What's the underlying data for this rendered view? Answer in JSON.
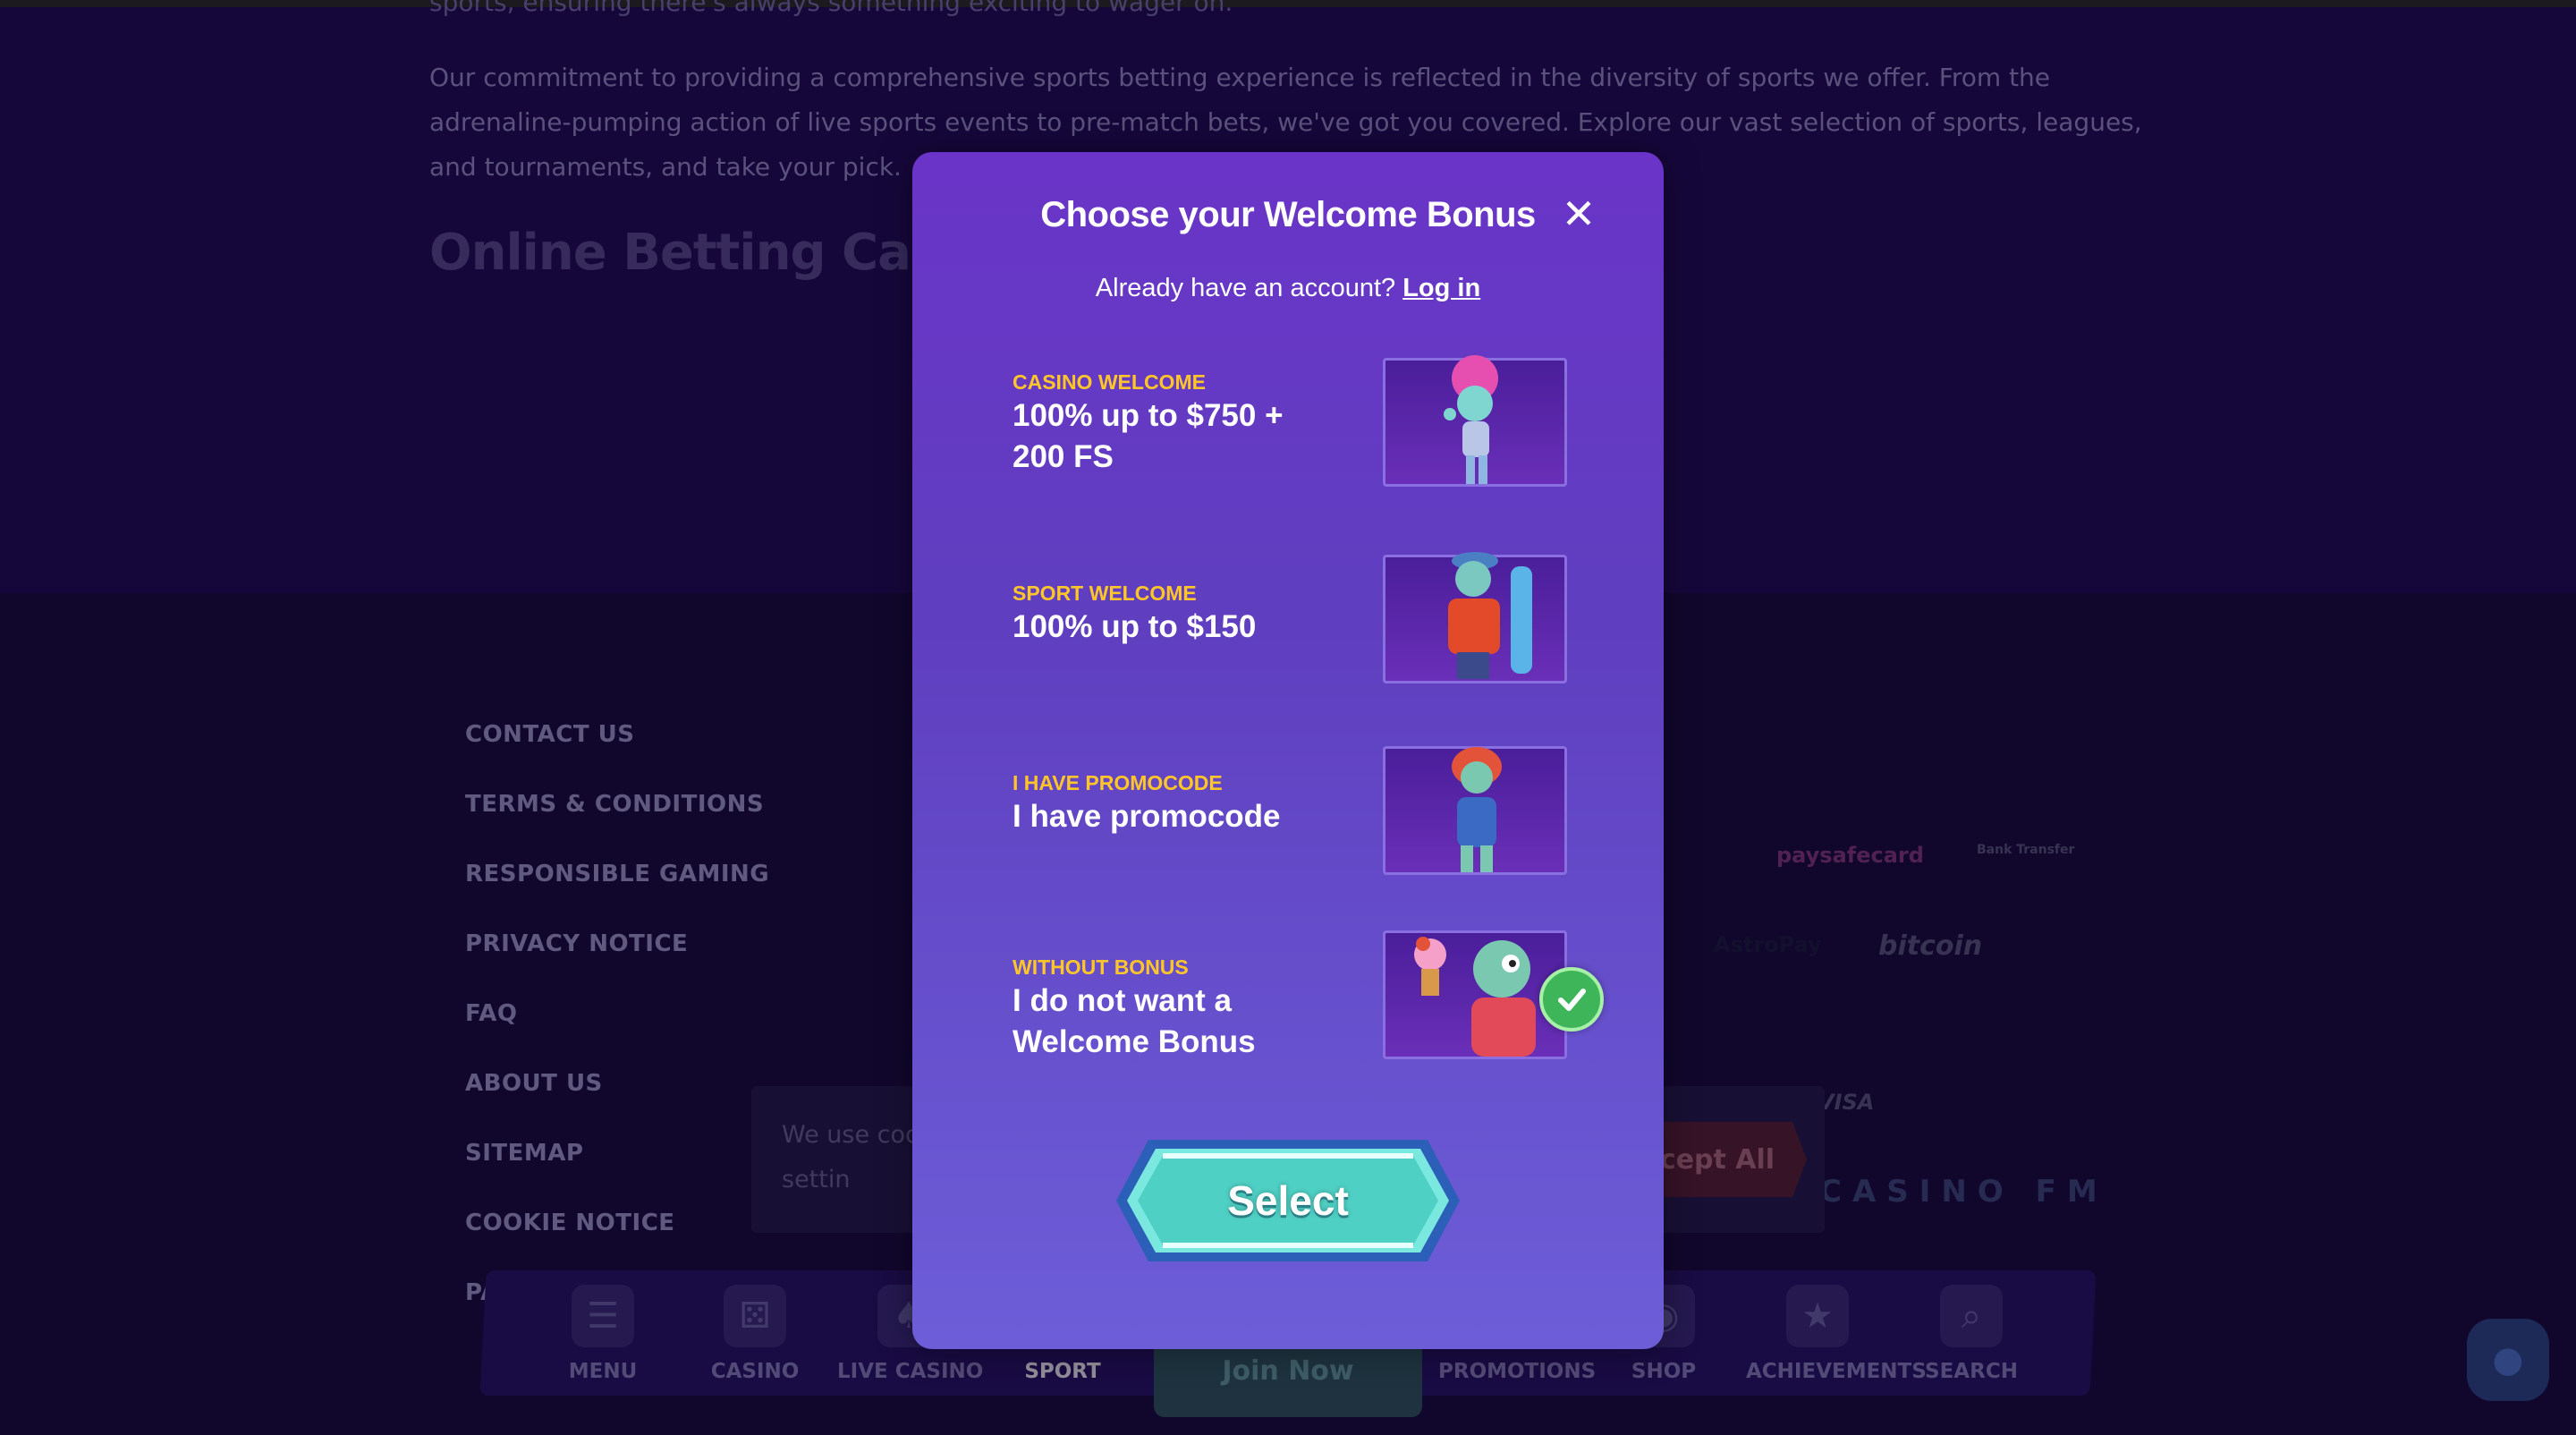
{
  "page": {
    "top_cut_text": "sports, ensuring there's always something exciting to wager on.",
    "intro_paragraph": "Our commitment to providing a comprehensive sports betting experience is reflected in the diversity of sports we offer. From the adrenaline-pumping action of live sports events to pre-match bets, we've got you covered. Explore our vast selection of sports, leagues, and tournaments, and take your pick.",
    "section_heading": "Online Betting Casombie"
  },
  "footer": {
    "links": [
      "CONTACT US",
      "TERMS & CONDITIONS",
      "RESPONSIBLE GAMING",
      "PRIVACY NOTICE",
      "FAQ",
      "ABOUT US",
      "SITEMAP",
      "COOKIE NOTICE",
      "PA"
    ],
    "payment_logos": {
      "paysafecard": "paysafecard",
      "bank_transfer": "Bank Transfer",
      "astropay": "AstroPay",
      "bitcoin": "bitcoin",
      "visa": "VISA",
      "casino_fm": "CASINO FM"
    }
  },
  "cookie": {
    "text": "We use coo these settin",
    "accept_label": "cept All"
  },
  "bottom_nav": {
    "items": [
      {
        "label": "MENU",
        "icon": "menu-icon"
      },
      {
        "label": "CASINO",
        "icon": "dice-icon"
      },
      {
        "label": "LIVE CASINO",
        "icon": "cards-icon"
      },
      {
        "label": "SPORT",
        "icon": "ball-icon"
      },
      {
        "label": "PROMOTIONS",
        "icon": "gift-icon"
      },
      {
        "label": "SHOP",
        "icon": "shop-icon"
      },
      {
        "label": "ACHIEVEMENTS",
        "icon": "trophy-icon"
      },
      {
        "label": "SEARCH",
        "icon": "search-icon"
      }
    ],
    "join_label": "Join Now"
  },
  "modal": {
    "title": "Choose your Welcome Bonus",
    "close_icon": "close-icon",
    "account_prompt": "Already have an account?",
    "login_label": "Log in",
    "options": [
      {
        "type": "CASINO WELCOME",
        "desc": "100% up to $750 + 200 FS",
        "image": "zombie-girl-character",
        "selected": false
      },
      {
        "type": "SPORT WELCOME",
        "desc": "100% up to $150",
        "image": "zombie-skateboarder-character",
        "selected": false
      },
      {
        "type": "I HAVE PROMOCODE",
        "desc": "I have promocode",
        "image": "zombie-redhead-character",
        "selected": false
      },
      {
        "type": "WITHOUT BONUS",
        "desc": "I do not want a Welcome Bonus",
        "image": "zombie-icecream-character",
        "selected": true
      }
    ],
    "select_label": "Select",
    "colors": {
      "accent_label": "#ffc629",
      "check_green": "#3fb55a",
      "button_teal": "#4fd0c4"
    }
  }
}
